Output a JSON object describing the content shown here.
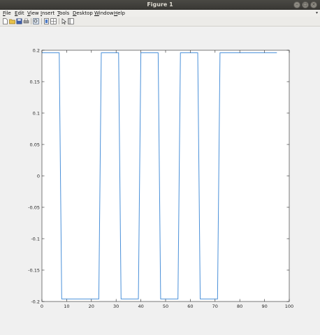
{
  "window": {
    "title": "Figure 1",
    "controls": [
      "minimize-icon",
      "maximize-icon",
      "close-icon"
    ]
  },
  "menu": {
    "items": [
      {
        "label": "File",
        "key": "F"
      },
      {
        "label": "Edit",
        "key": "E"
      },
      {
        "label": "View",
        "key": "V"
      },
      {
        "label": "Insert",
        "key": "I"
      },
      {
        "label": "Tools",
        "key": "T"
      },
      {
        "label": "Desktop",
        "key": "D"
      },
      {
        "label": "Window",
        "key": "W"
      },
      {
        "label": "Help",
        "key": "H"
      }
    ]
  },
  "toolbar": {
    "icons": [
      "new-figure-icon",
      "open-file-icon",
      "save-icon",
      "print-icon",
      "zoom-icon",
      "link-plot-icon",
      "insert-colorbar-icon",
      "pointer-icon",
      "plot-tools-icon"
    ]
  },
  "colors": {
    "line": "#4a90d9",
    "axes": "#262626",
    "plot_bg": "#ffffff"
  },
  "chart_data": {
    "type": "line",
    "title": "",
    "xlabel": "",
    "ylabel": "",
    "xlim": [
      0,
      100
    ],
    "ylim": [
      -0.2,
      0.2
    ],
    "xticks": [
      0,
      10,
      20,
      30,
      40,
      50,
      60,
      70,
      80,
      90,
      100
    ],
    "yticks": [
      0.2,
      0.15,
      0.1,
      0.05,
      0,
      -0.05,
      -0.1,
      -0.15,
      -0.2
    ],
    "xtick_labels": [
      "0",
      "10",
      "20",
      "30",
      "40",
      "50",
      "60",
      "70",
      "80",
      "90",
      "100"
    ],
    "ytick_labels": [
      "0.2",
      "0.15",
      "0.1",
      "0.05",
      "0",
      "-0.05",
      "-0.1",
      "-0.15",
      "-0.2"
    ],
    "grid": false,
    "series": [
      {
        "x": [
          0,
          7,
          8,
          23,
          24,
          31,
          32,
          39,
          40,
          47,
          48,
          55,
          56,
          63,
          64,
          71,
          72,
          95
        ],
        "y": [
          0.196,
          0.196,
          -0.196,
          -0.196,
          0.196,
          0.196,
          -0.196,
          -0.196,
          0.196,
          0.196,
          -0.196,
          -0.196,
          0.196,
          0.196,
          -0.196,
          -0.196,
          0.196,
          0.196
        ]
      }
    ]
  }
}
